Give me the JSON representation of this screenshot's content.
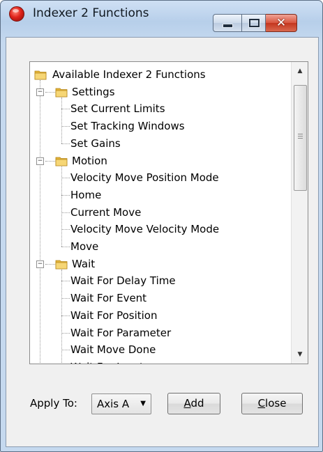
{
  "window": {
    "title": "Indexer 2 Functions",
    "close_glyph": "✕"
  },
  "tree": {
    "root": "Available Indexer 2 Functions",
    "groups": [
      {
        "label": "Settings",
        "items": [
          "Set Current Limits",
          "Set Tracking Windows",
          "Set Gains"
        ]
      },
      {
        "label": "Motion",
        "items": [
          "Velocity Move Position Mode",
          "Home",
          "Current Move",
          "Velocity Move Velocity Mode",
          "Move"
        ]
      },
      {
        "label": "Wait",
        "items": [
          "Wait For Delay Time",
          "Wait For Event",
          "Wait For Position",
          "Wait For Parameter",
          "Wait Move Done",
          "Wait For Input"
        ]
      }
    ],
    "expander_glyph": "−"
  },
  "footer": {
    "apply_label": "Apply To:",
    "axis_value": "Axis A",
    "add_mnemonic": "A",
    "add_rest": "dd",
    "close_mnemonic": "C",
    "close_rest": "lose"
  },
  "icons": {
    "folder": "folder-icon",
    "app": "app-icon",
    "minimize": "minimize-icon",
    "maximize": "maximize-icon",
    "close": "close-icon"
  },
  "colors": {
    "title_bar": "#b7cfea",
    "close_button": "#c4361f",
    "folder_yellow": "#f2c94c"
  }
}
